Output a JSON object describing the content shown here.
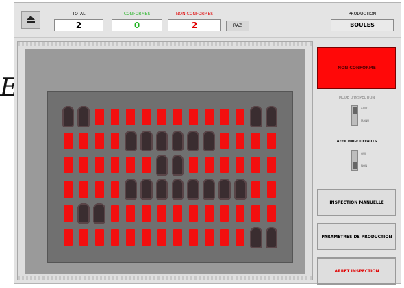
{
  "overlay_text": "EX",
  "topbar": {
    "eject_icon": "eject-icon",
    "counters": [
      {
        "label": "TOTAL",
        "value": "2",
        "label_color": "#000000",
        "value_color": "#000000"
      },
      {
        "label": "CONFORMES",
        "value": "0",
        "label_color": "#22b322",
        "value_color": "#22b322"
      },
      {
        "label": "NON CONFORMES",
        "value": "2",
        "label_color": "#e00000",
        "value_color": "#e00000"
      }
    ],
    "reset_label": "RAZ",
    "production_label": "PRODUCTION",
    "production_value": "BOULES"
  },
  "grid": {
    "rows": 6,
    "cols": 14,
    "bottles": [
      [
        0,
        0
      ],
      [
        0,
        1
      ],
      [
        0,
        12
      ],
      [
        0,
        13
      ],
      [
        1,
        4
      ],
      [
        1,
        5
      ],
      [
        1,
        6
      ],
      [
        1,
        7
      ],
      [
        1,
        8
      ],
      [
        1,
        9
      ],
      [
        2,
        6
      ],
      [
        2,
        7
      ],
      [
        3,
        4
      ],
      [
        3,
        5
      ],
      [
        3,
        6
      ],
      [
        3,
        7
      ],
      [
        3,
        8
      ],
      [
        3,
        9
      ],
      [
        3,
        10
      ],
      [
        3,
        11
      ],
      [
        4,
        1
      ],
      [
        4,
        2
      ],
      [
        5,
        12
      ],
      [
        5,
        13
      ]
    ],
    "red_color": "#f20f0f"
  },
  "right_panel": {
    "status_text": "NON CONFORME",
    "status_color": "#ff0808",
    "mode_label": "MODE D'INSPECTION",
    "mode_options": [
      "AUTO",
      "MANU"
    ],
    "display_label": "AFFICHAGE DEFAUTS",
    "display_options": [
      "OUI",
      "NON"
    ],
    "buttons": [
      {
        "label": "INSPECTION MANUELLE",
        "color": "#111111"
      },
      {
        "label": "PARAMETRES DE PRODUCTION",
        "color": "#111111"
      },
      {
        "label": "ARRET INSPECTION",
        "color": "#e00000"
      }
    ]
  }
}
